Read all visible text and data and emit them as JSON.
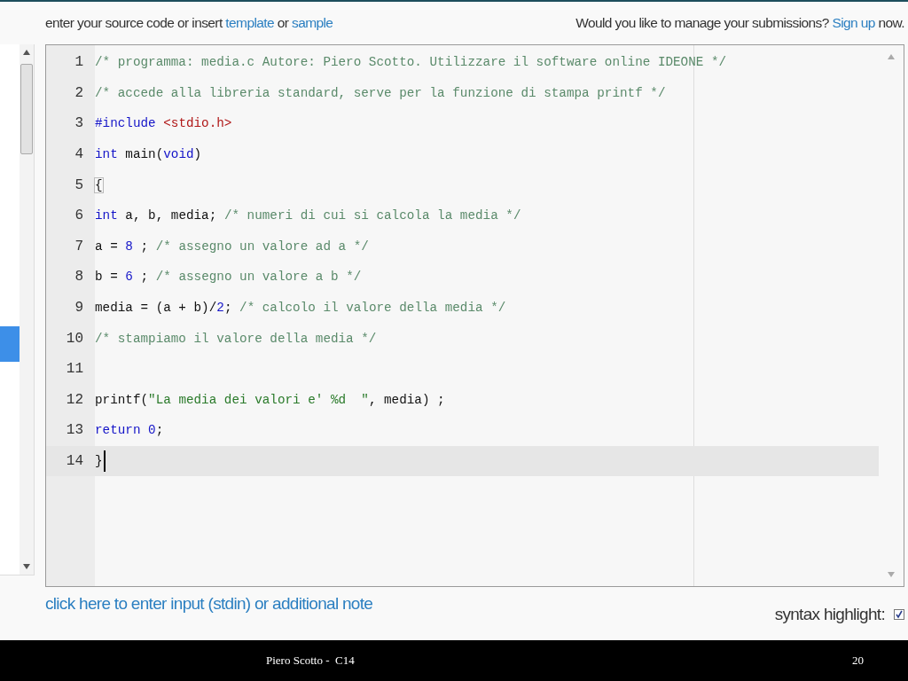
{
  "header": {
    "prompt": [
      {
        "kind": "text",
        "text": "enter your source code or insert "
      },
      {
        "kind": "link",
        "text": "template"
      },
      {
        "kind": "text",
        "text": " or "
      },
      {
        "kind": "link",
        "text": "sample"
      }
    ],
    "account": [
      {
        "kind": "text",
        "text": "Would you like to manage your submissions? "
      },
      {
        "kind": "link",
        "text": "Sign up"
      },
      {
        "kind": "text",
        "text": " now."
      }
    ]
  },
  "editor": {
    "lines": [
      {
        "number": "1",
        "active": false,
        "cursor": false,
        "tokens": [
          {
            "kind": "comment",
            "text": "/* programma: media.c Autore: Piero Scotto. Utilizzare il software online IDEONE */"
          }
        ]
      },
      {
        "number": "2",
        "active": false,
        "cursor": false,
        "tokens": [
          {
            "kind": "comment",
            "text": "/* accede alla libreria standard, serve per la funzione di stampa printf */"
          }
        ]
      },
      {
        "number": "3",
        "active": false,
        "cursor": false,
        "tokens": [
          {
            "kind": "keyword",
            "text": "#include "
          },
          {
            "kind": "header",
            "text": "<stdio.h>"
          }
        ]
      },
      {
        "number": "4",
        "active": false,
        "cursor": false,
        "tokens": [
          {
            "kind": "keyword",
            "text": "int"
          },
          {
            "kind": "plain",
            "text": " main("
          },
          {
            "kind": "keyword",
            "text": "void"
          },
          {
            "kind": "plain",
            "text": ")"
          }
        ]
      },
      {
        "number": "5",
        "active": false,
        "cursor": false,
        "tokens": [
          {
            "kind": "bracket",
            "text": "{"
          }
        ]
      },
      {
        "number": "6",
        "active": false,
        "cursor": false,
        "tokens": [
          {
            "kind": "keyword",
            "text": "int"
          },
          {
            "kind": "plain",
            "text": " a, b, media; "
          },
          {
            "kind": "comment",
            "text": "/* numeri di cui si calcola la media */"
          }
        ]
      },
      {
        "number": "7",
        "active": false,
        "cursor": false,
        "tokens": [
          {
            "kind": "plain",
            "text": "a = "
          },
          {
            "kind": "number",
            "text": "8"
          },
          {
            "kind": "plain",
            "text": " ; "
          },
          {
            "kind": "comment",
            "text": "/* assegno un valore ad a */"
          }
        ]
      },
      {
        "number": "8",
        "active": false,
        "cursor": false,
        "tokens": [
          {
            "kind": "plain",
            "text": "b = "
          },
          {
            "kind": "number",
            "text": "6"
          },
          {
            "kind": "plain",
            "text": " ; "
          },
          {
            "kind": "comment",
            "text": "/* assegno un valore a b */"
          }
        ]
      },
      {
        "number": "9",
        "active": false,
        "cursor": false,
        "tokens": [
          {
            "kind": "plain",
            "text": "media = (a + b)/"
          },
          {
            "kind": "number",
            "text": "2"
          },
          {
            "kind": "plain",
            "text": "; "
          },
          {
            "kind": "comment",
            "text": "/* calcolo il valore della media */"
          }
        ]
      },
      {
        "number": "10",
        "active": false,
        "cursor": false,
        "tokens": [
          {
            "kind": "comment",
            "text": "/* stampiamo il valore della media */"
          }
        ]
      },
      {
        "number": "11",
        "active": false,
        "cursor": false
      },
      {
        "number": "12",
        "active": false,
        "cursor": false,
        "tokens": [
          {
            "kind": "plain",
            "text": "printf("
          },
          {
            "kind": "string",
            "text": "\"La media dei valori e' %d  \""
          },
          {
            "kind": "plain",
            "text": ", media) ;"
          }
        ]
      },
      {
        "number": "13",
        "active": false,
        "cursor": false,
        "tokens": [
          {
            "kind": "keyword",
            "text": "return "
          },
          {
            "kind": "number",
            "text": "0"
          },
          {
            "kind": "plain",
            "text": ";"
          }
        ]
      },
      {
        "number": "14",
        "active": true,
        "cursor": true,
        "tokens": [
          {
            "kind": "plain",
            "text": "}"
          }
        ]
      }
    ]
  },
  "input_link": "click here to enter input (stdin) or additional note",
  "syntax_highlight": {
    "label": "syntax highlight:",
    "checked": true
  },
  "slide_footer": {
    "author": "Piero Scotto -  C14",
    "page": "20"
  }
}
